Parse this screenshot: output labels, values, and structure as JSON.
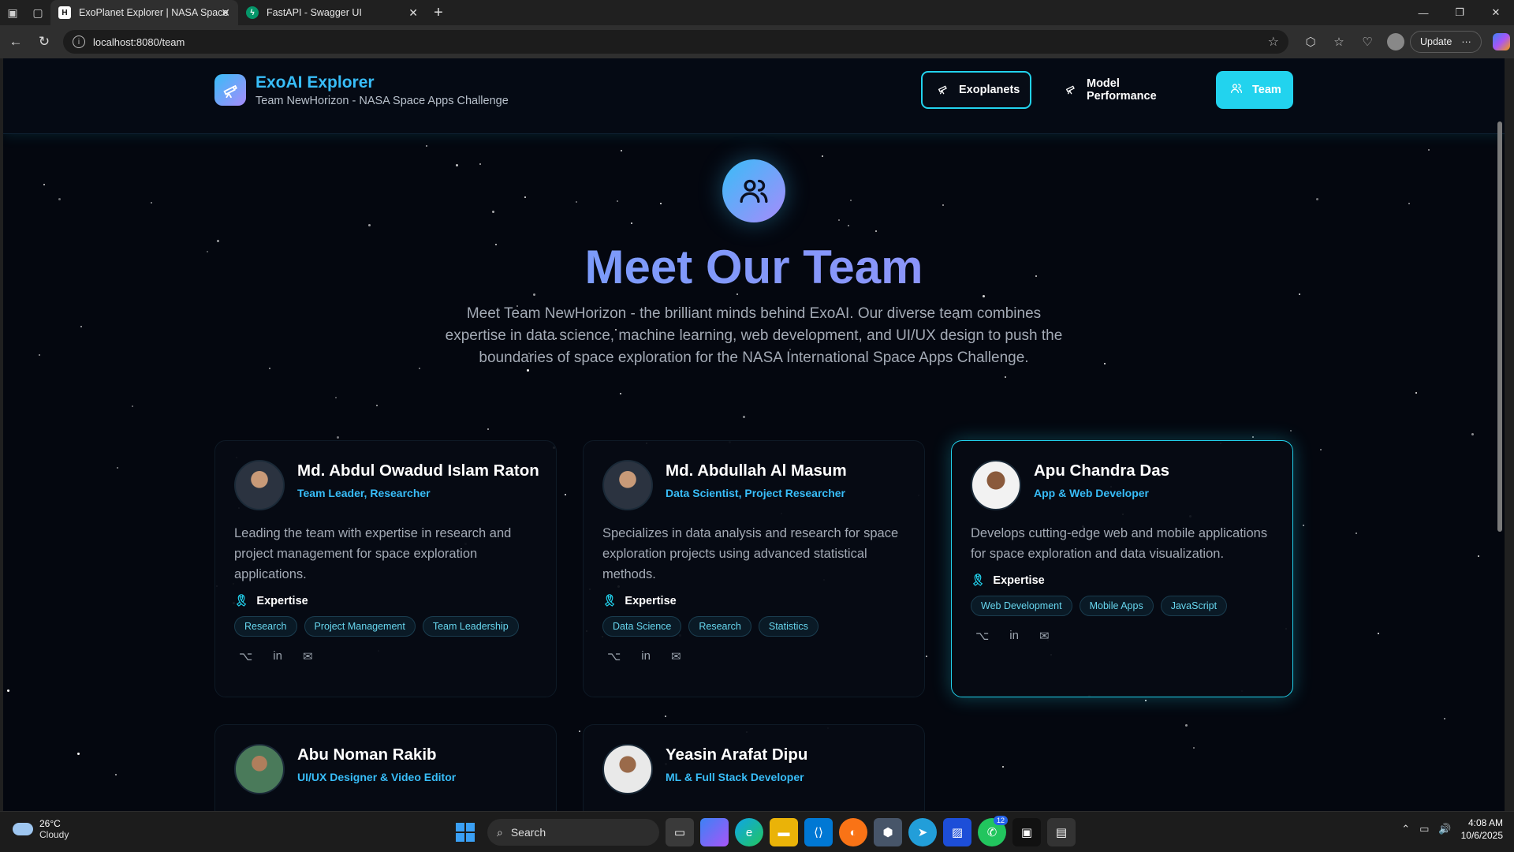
{
  "browser": {
    "tabs": [
      {
        "title": "ExoPlanet Explorer | NASA Space",
        "active": true
      },
      {
        "title": "FastAPI - Swagger UI",
        "active": false
      }
    ],
    "url": "localhost:8080/team",
    "update_label": "Update"
  },
  "header": {
    "brand_title": "ExoAI Explorer",
    "brand_subtitle": "Team NewHorizon - NASA Space Apps Challenge",
    "nav": [
      {
        "label": "Exoplanets"
      },
      {
        "label": "Model Performance"
      },
      {
        "label": "Team"
      }
    ]
  },
  "hero": {
    "title": "Meet Our Team",
    "description": "Meet Team NewHorizon - the brilliant minds behind ExoAI. Our diverse team combines expertise in data science, machine learning, web development, and UI/UX design to push the boundaries of space exploration for the NASA International Space Apps Challenge."
  },
  "team": [
    {
      "name": "Md. Abdul Owadud Islam Raton",
      "role": "Team Leader, Researcher",
      "description": "Leading the team with expertise in research and project management for space exploration applications.",
      "expertise_label": "Expertise",
      "tags": [
        "Research",
        "Project Management",
        "Team Leadership"
      ]
    },
    {
      "name": "Md. Abdullah Al Masum",
      "role": "Data Scientist, Project Researcher",
      "description": "Specializes in data analysis and research for space exploration projects using advanced statistical methods.",
      "expertise_label": "Expertise",
      "tags": [
        "Data Science",
        "Research",
        "Statistics"
      ]
    },
    {
      "name": "Apu Chandra Das",
      "role": "App & Web Developer",
      "description": "Develops cutting-edge web and mobile applications for space exploration and data visualization.",
      "expertise_label": "Expertise",
      "tags": [
        "Web Development",
        "Mobile Apps",
        "JavaScript"
      ]
    },
    {
      "name": "Abu Noman Rakib",
      "role": "UI/UX Designer & Video Editor"
    },
    {
      "name": "Yeasin Arafat Dipu",
      "role": "ML & Full Stack Developer"
    }
  ],
  "taskbar": {
    "weather_temp": "26°C",
    "weather_desc": "Cloudy",
    "search_label": "Search",
    "whatsapp_badge": "12",
    "time": "4:08 AM",
    "date": "10/6/2025"
  },
  "colors": {
    "accent": "#22d3ee",
    "brand_gradient_start": "#38bdf8",
    "brand_gradient_end": "#a78bfa",
    "page_bg": "#04070f"
  }
}
